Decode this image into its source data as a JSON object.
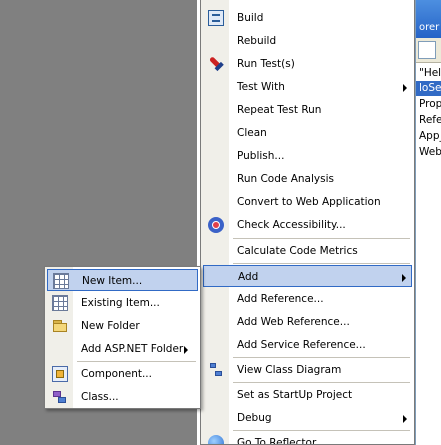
{
  "context_menu": {
    "items": [
      {
        "label": "Build",
        "icon": "build-icon"
      },
      {
        "label": "Rebuild"
      },
      {
        "label": "Run Test(s)",
        "icon": "rocket-icon"
      },
      {
        "label": "Test With",
        "submenu": true
      },
      {
        "label": "Repeat Test Run"
      },
      {
        "label": "Clean"
      },
      {
        "label": "Publish..."
      },
      {
        "label": "Run Code Analysis"
      },
      {
        "label": "Convert to Web Application"
      },
      {
        "label": "Check Accessibility...",
        "icon": "accessibility-icon"
      },
      {
        "label": "Calculate Code Metrics"
      },
      {
        "label": "Add",
        "submenu": true,
        "highlighted": true
      },
      {
        "label": "Add Reference..."
      },
      {
        "label": "Add Web Reference..."
      },
      {
        "label": "Add Service Reference..."
      },
      {
        "label": "View Class Diagram",
        "icon": "class-diagram-icon"
      },
      {
        "label": "Set as StartUp Project"
      },
      {
        "label": "Debug",
        "submenu": true
      },
      {
        "label": "Go To Reflector",
        "icon": "reflector-icon"
      }
    ]
  },
  "add_submenu": {
    "items": [
      {
        "label": "New Item...",
        "icon": "new-item-icon",
        "highlighted": true
      },
      {
        "label": "Existing Item...",
        "icon": "existing-item-icon"
      },
      {
        "label": "New Folder",
        "icon": "folder-icon"
      },
      {
        "label": "Add ASP.NET Folder",
        "submenu": true
      },
      {
        "label": "Component...",
        "icon": "component-icon"
      },
      {
        "label": "Class...",
        "icon": "class-icon"
      }
    ]
  },
  "solution_explorer": {
    "title_fragment": "orer",
    "rows": [
      "\"Hell",
      "loSe",
      "Prop",
      "Refe",
      "App_",
      "Web"
    ],
    "selected_row": 1
  },
  "colors": {
    "highlight_bg": "#c1d2ee",
    "highlight_border": "#316ac5",
    "gutter": "#f0efe9",
    "desktop_gray": "#808080"
  }
}
